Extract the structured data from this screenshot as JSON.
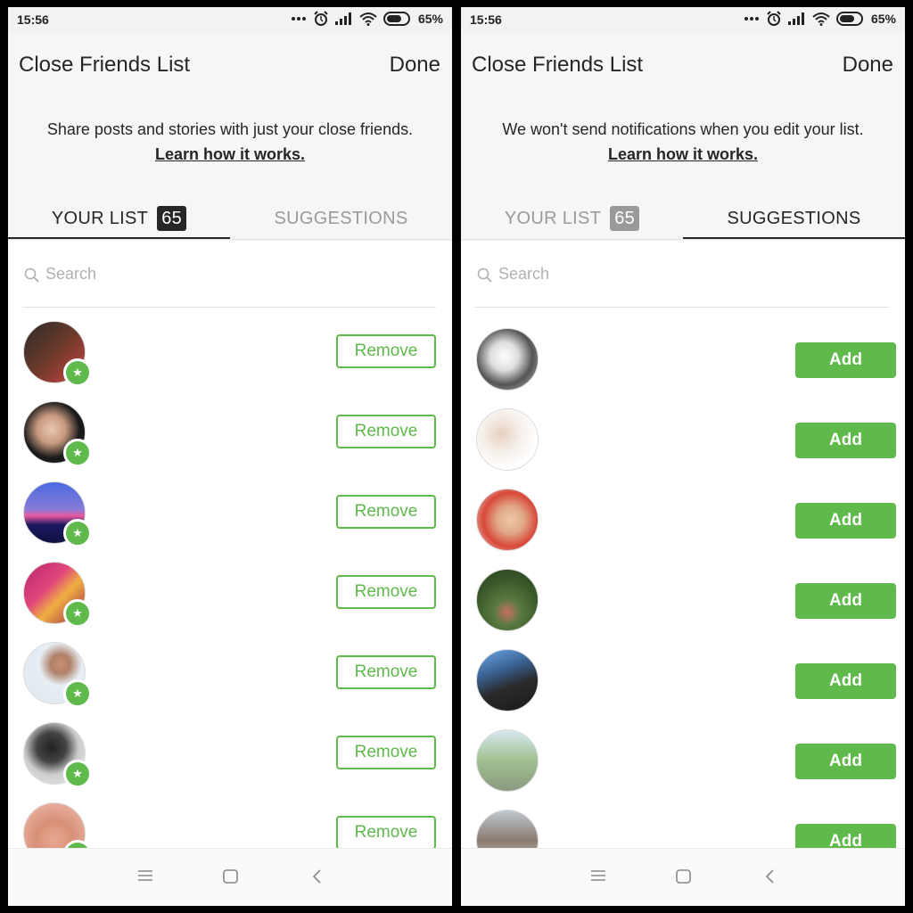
{
  "status": {
    "time": "15:56",
    "battery": "65%"
  },
  "screens": [
    {
      "title": "Close Friends List",
      "done_label": "Done",
      "description": "Share posts and stories with just your close friends.",
      "learn_link": "Learn how it works.",
      "tabs": {
        "your_list": "YOUR LIST",
        "count": "65",
        "suggestions": "SUGGESTIONS",
        "active": "your_list"
      },
      "search_placeholder": "Search",
      "row_button_label": "Remove",
      "rows": 7
    },
    {
      "title": "Close Friends List",
      "done_label": "Done",
      "description": "We won't send notifications when you edit your list.",
      "learn_link": "Learn how it works.",
      "tabs": {
        "your_list": "YOUR LIST",
        "count": "65",
        "suggestions": "SUGGESTIONS",
        "active": "suggestions"
      },
      "search_placeholder": "Search",
      "row_button_label": "Add",
      "rows": 7
    }
  ],
  "colors": {
    "accent_green": "#5fb94b",
    "text": "#262626",
    "inactive": "#9a9a9a"
  },
  "icons": [
    "more-icon",
    "alarm-icon",
    "signal-icon",
    "wifi-icon",
    "battery-icon",
    "search-icon",
    "star-icon",
    "menu-icon",
    "home-icon",
    "back-icon"
  ]
}
